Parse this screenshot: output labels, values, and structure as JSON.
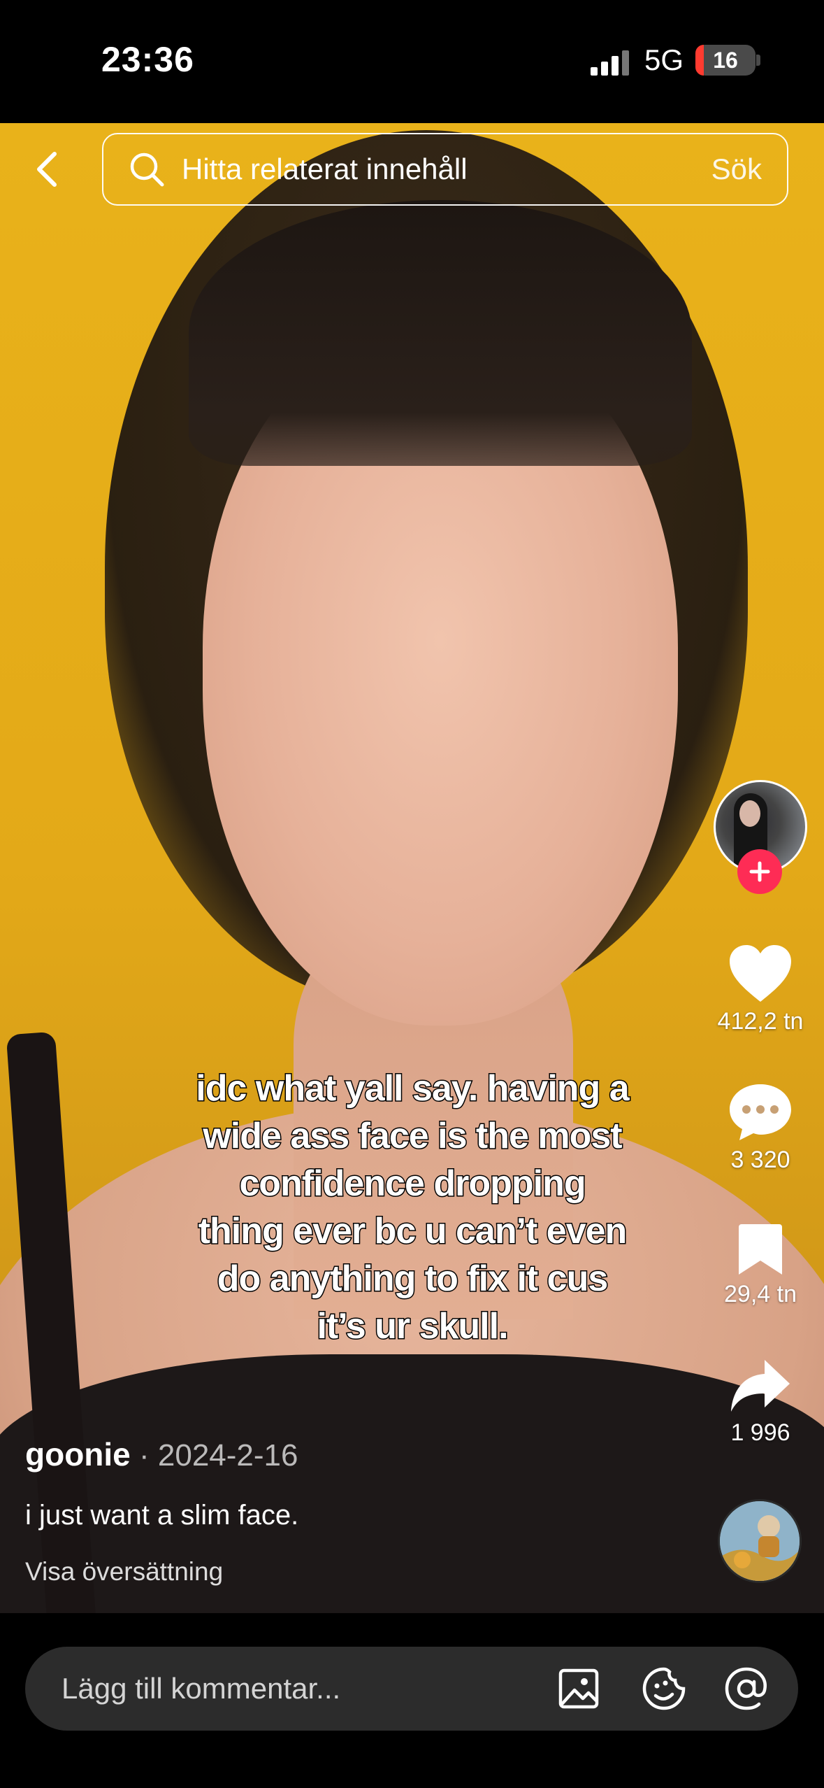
{
  "status_bar": {
    "time": "23:36",
    "network": "5G",
    "battery": "16"
  },
  "search": {
    "placeholder": "Hitta relaterat innehåll",
    "submit_label": "Sök"
  },
  "video": {
    "overlay_lines": [
      "idc what yall say. having a",
      "wide ass face is the most",
      "confidence dropping",
      "thing ever bc u can’t even",
      "do anything to fix it cus",
      "it’s ur skull."
    ]
  },
  "actions": {
    "likes": "412,2 tn",
    "comments": "3 320",
    "saves": "29,4 tn",
    "shares": "1 996"
  },
  "post": {
    "author": "goonie",
    "separator": " · ",
    "date": "2024-2-16",
    "description": "i just want a slim face.",
    "translate_label": "Visa översättning"
  },
  "comment_bar": {
    "placeholder": "Lägg till kommentar..."
  },
  "icons": [
    "back-icon",
    "search-icon",
    "heart-icon",
    "comment-icon",
    "bookmark-icon",
    "share-icon",
    "image-icon",
    "emoji-icon",
    "mention-icon",
    "plus-icon"
  ],
  "colors": {
    "accent": "#fe2c55",
    "background": "#000000",
    "comment_box": "#2c2c2c"
  }
}
